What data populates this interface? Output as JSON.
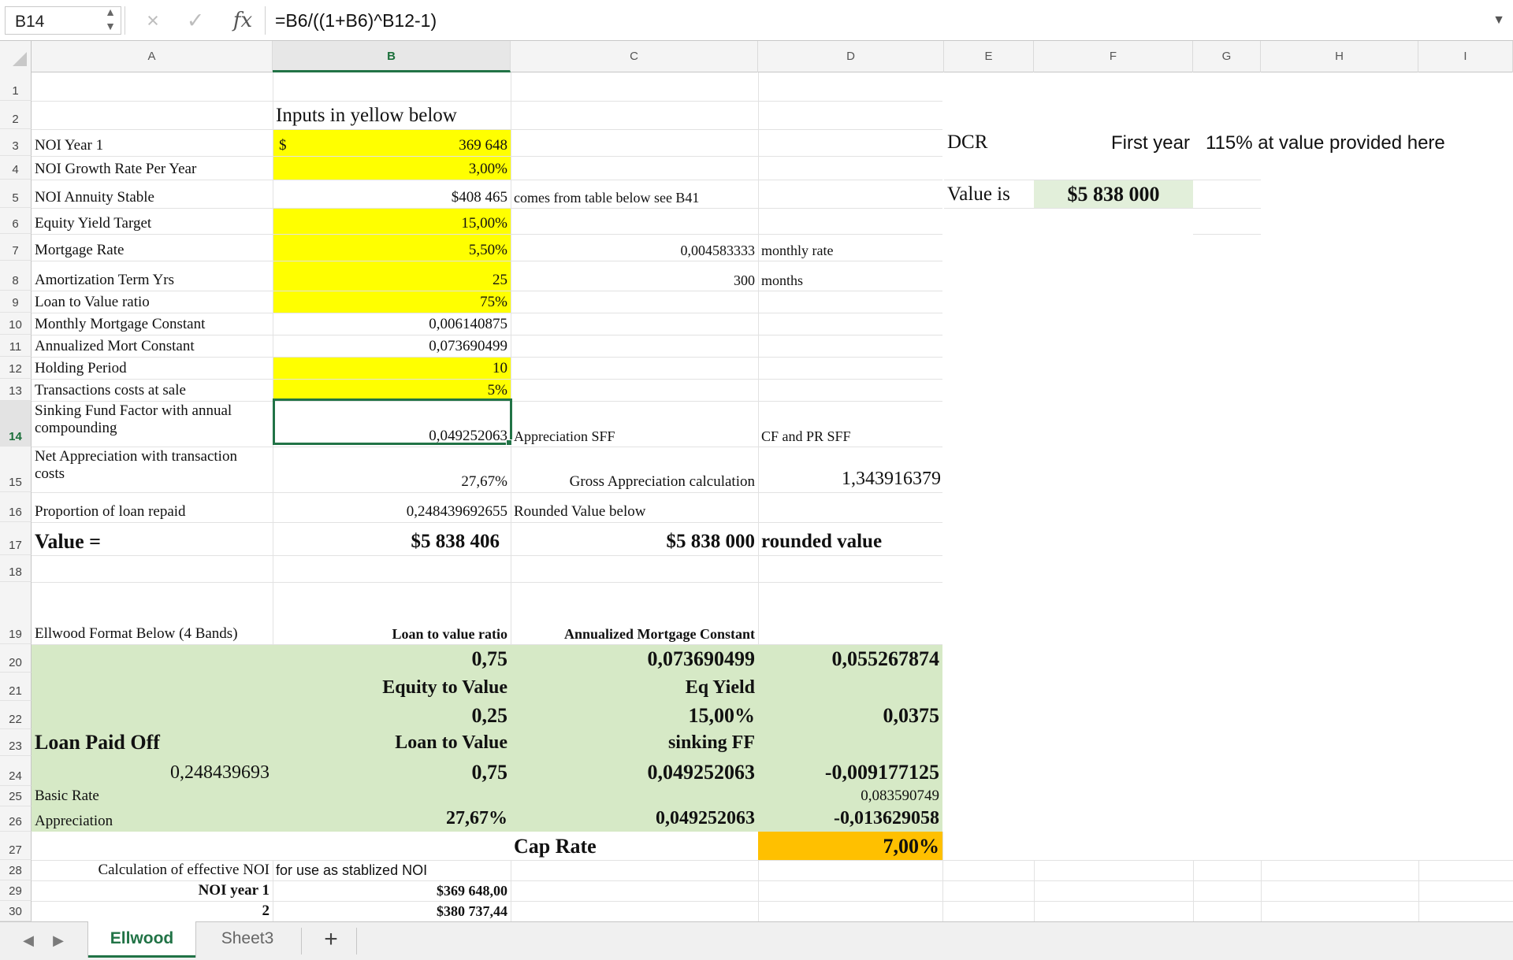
{
  "formula_bar": {
    "name_box": "B14",
    "cancel_icon": "×",
    "enter_icon": "✓",
    "fx_label": "fx",
    "formula": "=B6/((1+B6)^B12-1)"
  },
  "columns": [
    "A",
    "B",
    "C",
    "D",
    "E",
    "F",
    "G",
    "H",
    "I"
  ],
  "selected_column": "B",
  "rows": [
    "1",
    "2",
    "3",
    "4",
    "5",
    "6",
    "7",
    "8",
    "9",
    "10",
    "11",
    "12",
    "13",
    "14",
    "15",
    "16",
    "17",
    "18",
    "19",
    "20",
    "21",
    "22",
    "23",
    "24",
    "25",
    "26",
    "27",
    "28",
    "29",
    "30"
  ],
  "selected_row": "14",
  "cells": {
    "B2": "Inputs in yellow below",
    "A3": "NOI Year 1",
    "B3_sym": "$",
    "B3": "369 648",
    "A4": "NOI Growth Rate Per Year",
    "B4": "3,00%",
    "A5": "NOI Annuity Stable",
    "B5": "$408 465",
    "C5": "comes from table below see B41",
    "A6": "Equity Yield Target",
    "B6": "15,00%",
    "A7": "Mortgage Rate",
    "B7": "5,50%",
    "C7": "0,004583333",
    "D7": "monthly rate",
    "A8": "Amortization Term Yrs",
    "B8": "25",
    "C8": "300",
    "D8": "months",
    "A9": "Loan to Value ratio",
    "B9": "75%",
    "A10": "Monthly Mortgage Constant",
    "B10": "0,006140875",
    "A11": "Annualized Mort Constant",
    "B11": "0,073690499",
    "A12": "Holding Period",
    "B12": "10",
    "A13": "Transactions costs at sale",
    "B13": "5%",
    "A14": "Sinking Fund Factor with annual compounding",
    "B14": "0,049252063",
    "C14": "Appreciation SFF",
    "D14": "CF and PR SFF",
    "A15": "Net Appreciation with transaction costs",
    "B15": "27,67%",
    "C15": "Gross Appreciation calculation",
    "D15": "1,343916379",
    "A16": "Proportion of loan repaid",
    "B16": "0,248439692655",
    "C16": "Rounded Value below",
    "A17": "Value =",
    "B17": "$5 838 406",
    "C17": "$5 838 000",
    "D17": "rounded value",
    "A19": "Ellwood Format Below (4 Bands)",
    "B19": "Loan to value ratio",
    "C19": "Annualized Mortgage Constant",
    "B20": "0,75",
    "C20": "0,073690499",
    "D20": "0,055267874",
    "B21": "Equity to Value",
    "C21": "Eq Yield",
    "B22": "0,25",
    "C22": "15,00%",
    "D22": "0,0375",
    "A23": "Loan Paid Off",
    "B23": "Loan to Value",
    "C23": "sinking FF",
    "A24": "0,248439693",
    "B24": "0,75",
    "C24": "0,049252063",
    "D24": "-0,009177125",
    "A25": "Basic Rate",
    "D25": "0,083590749",
    "A26": "Appreciation",
    "B26": "27,67%",
    "C26": "0,049252063",
    "D26": "-0,013629058",
    "C27": "Cap Rate",
    "D27": "7,00%",
    "A28": "Calculation of effective NOI",
    "B28": "for use as stablized NOI",
    "A29": "NOI year 1",
    "B29": "$369 648,00",
    "A30": "2",
    "B30": "$380 737,44",
    "E3": "DCR",
    "F3": "First year",
    "G3": "115% at value provided here",
    "E5": "Value is",
    "F5": "$5 838 000"
  },
  "sheet_tabs": [
    "Ellwood",
    "Sheet3"
  ],
  "active_tab": "Ellwood",
  "add_sheet_label": "+",
  "colors": {
    "input_yellow": "#ffff00",
    "band_green": "#d6e9c6",
    "cap_rate_orange": "#ffc000",
    "excel_green": "#217346"
  }
}
